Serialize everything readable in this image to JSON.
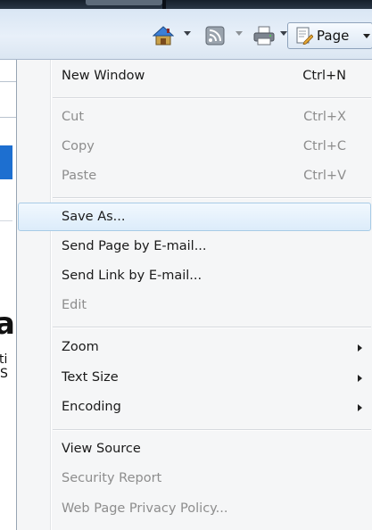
{
  "toolbar": {
    "page_label": "Page",
    "icons": [
      "home-icon",
      "feeds-icon",
      "print-icon",
      "page-icon"
    ]
  },
  "background_page": {
    "large_glyph": "a",
    "small_glyphs": [
      "ti",
      "S"
    ],
    "accent_color": "#1d6fd0"
  },
  "menu": {
    "new_window": {
      "label": "New Window",
      "shortcut": "Ctrl+N"
    },
    "cut": {
      "label": "Cut",
      "shortcut": "Ctrl+X"
    },
    "copy": {
      "label": "Copy",
      "shortcut": "Ctrl+C"
    },
    "paste": {
      "label": "Paste",
      "shortcut": "Ctrl+V"
    },
    "save_as": {
      "label": "Save As..."
    },
    "send_page": {
      "label": "Send Page by E-mail..."
    },
    "send_link": {
      "label": "Send Link by E-mail..."
    },
    "edit": {
      "label": "Edit"
    },
    "zoom": {
      "label": "Zoom"
    },
    "text_size": {
      "label": "Text Size"
    },
    "encoding": {
      "label": "Encoding"
    },
    "view_source": {
      "label": "View Source"
    },
    "security_report": {
      "label": "Security Report"
    },
    "privacy_policy": {
      "label": "Web Page Privacy Policy..."
    }
  },
  "colors": {
    "highlight_border": "#a8cbe6",
    "disabled_text": "#8d8d8d",
    "menu_background": "#f5f6f7"
  }
}
